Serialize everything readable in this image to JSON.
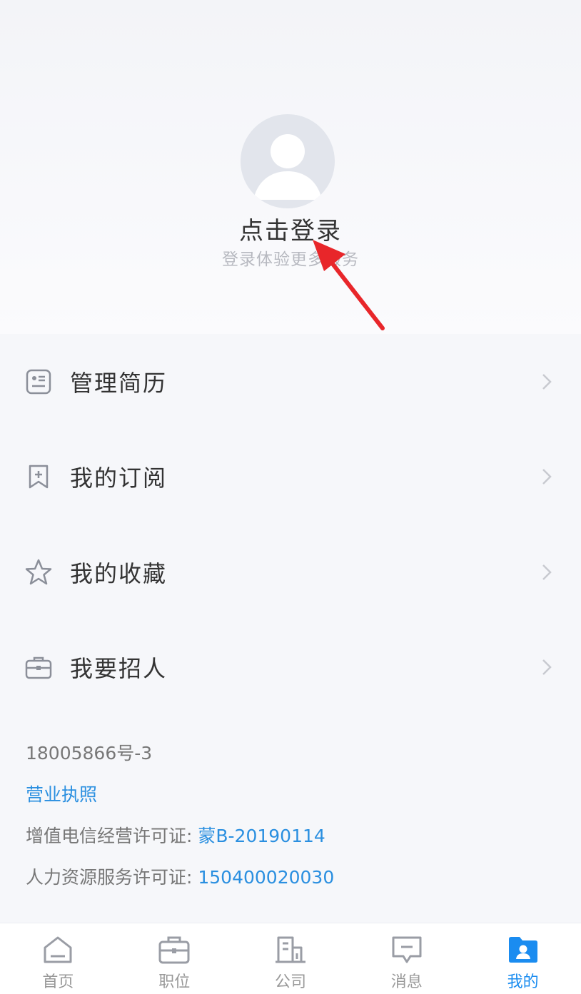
{
  "header": {
    "title": "点击登录",
    "subtitle": "登录体验更多服务"
  },
  "menu": {
    "items": [
      {
        "label": "管理简历",
        "icon": "resume-icon"
      },
      {
        "label": "我的订阅",
        "icon": "bookmark-icon"
      },
      {
        "label": "我的收藏",
        "icon": "star-icon"
      },
      {
        "label": "我要招人",
        "icon": "briefcase-icon"
      }
    ]
  },
  "footer_info": {
    "icp": "18005866号-3",
    "business_license": "营业执照",
    "telecom_label": "增值电信经营许可证: ",
    "telecom_value": "蒙B-20190114",
    "hr_label": "人力资源服务许可证: ",
    "hr_value": "150400020030"
  },
  "tabbar": {
    "tabs": [
      {
        "label": "首页",
        "icon": "home-icon"
      },
      {
        "label": "职位",
        "icon": "briefcase-icon"
      },
      {
        "label": "公司",
        "icon": "building-icon"
      },
      {
        "label": "消息",
        "icon": "message-icon"
      },
      {
        "label": "我的",
        "icon": "profile-icon",
        "active": true
      }
    ]
  },
  "colors": {
    "accent": "#1a8cf0",
    "link": "#2a8fe0",
    "arrow": "#e8262a"
  }
}
